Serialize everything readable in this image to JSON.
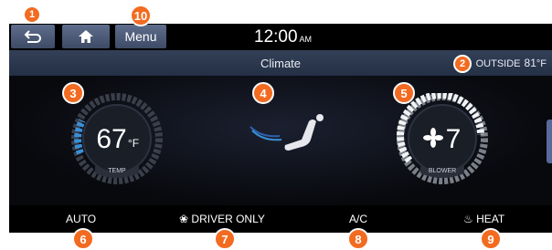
{
  "topbar": {
    "back_icon": "back-arrow-icon",
    "home_icon": "home-icon",
    "menu_label": "Menu",
    "time": "12:00",
    "ampm": "AM"
  },
  "titlebar": {
    "title": "Climate",
    "outside_label": "OUTSIDE",
    "outside_temp": "81",
    "outside_unit": "°F"
  },
  "temp_dial": {
    "value": "67",
    "unit": "°F",
    "label": "TEMP"
  },
  "airflow": {
    "icon": "seat-airflow-icon"
  },
  "blower_dial": {
    "value": "7",
    "label": "BLOWER",
    "icon": "fan-icon"
  },
  "bottombar": {
    "auto": "AUTO",
    "driver_only": "DRIVER ONLY",
    "driver_only_icon": "fan-icon",
    "ac": "A/C",
    "heat": "HEAT",
    "heat_icon": "heat-icon"
  },
  "callouts": [
    "1",
    "2",
    "3",
    "4",
    "5",
    "6",
    "7",
    "8",
    "9",
    "10"
  ],
  "colors": {
    "accent": "#f26b21",
    "bar": "#2b3850",
    "temp_blue": "#3a8fd6"
  }
}
